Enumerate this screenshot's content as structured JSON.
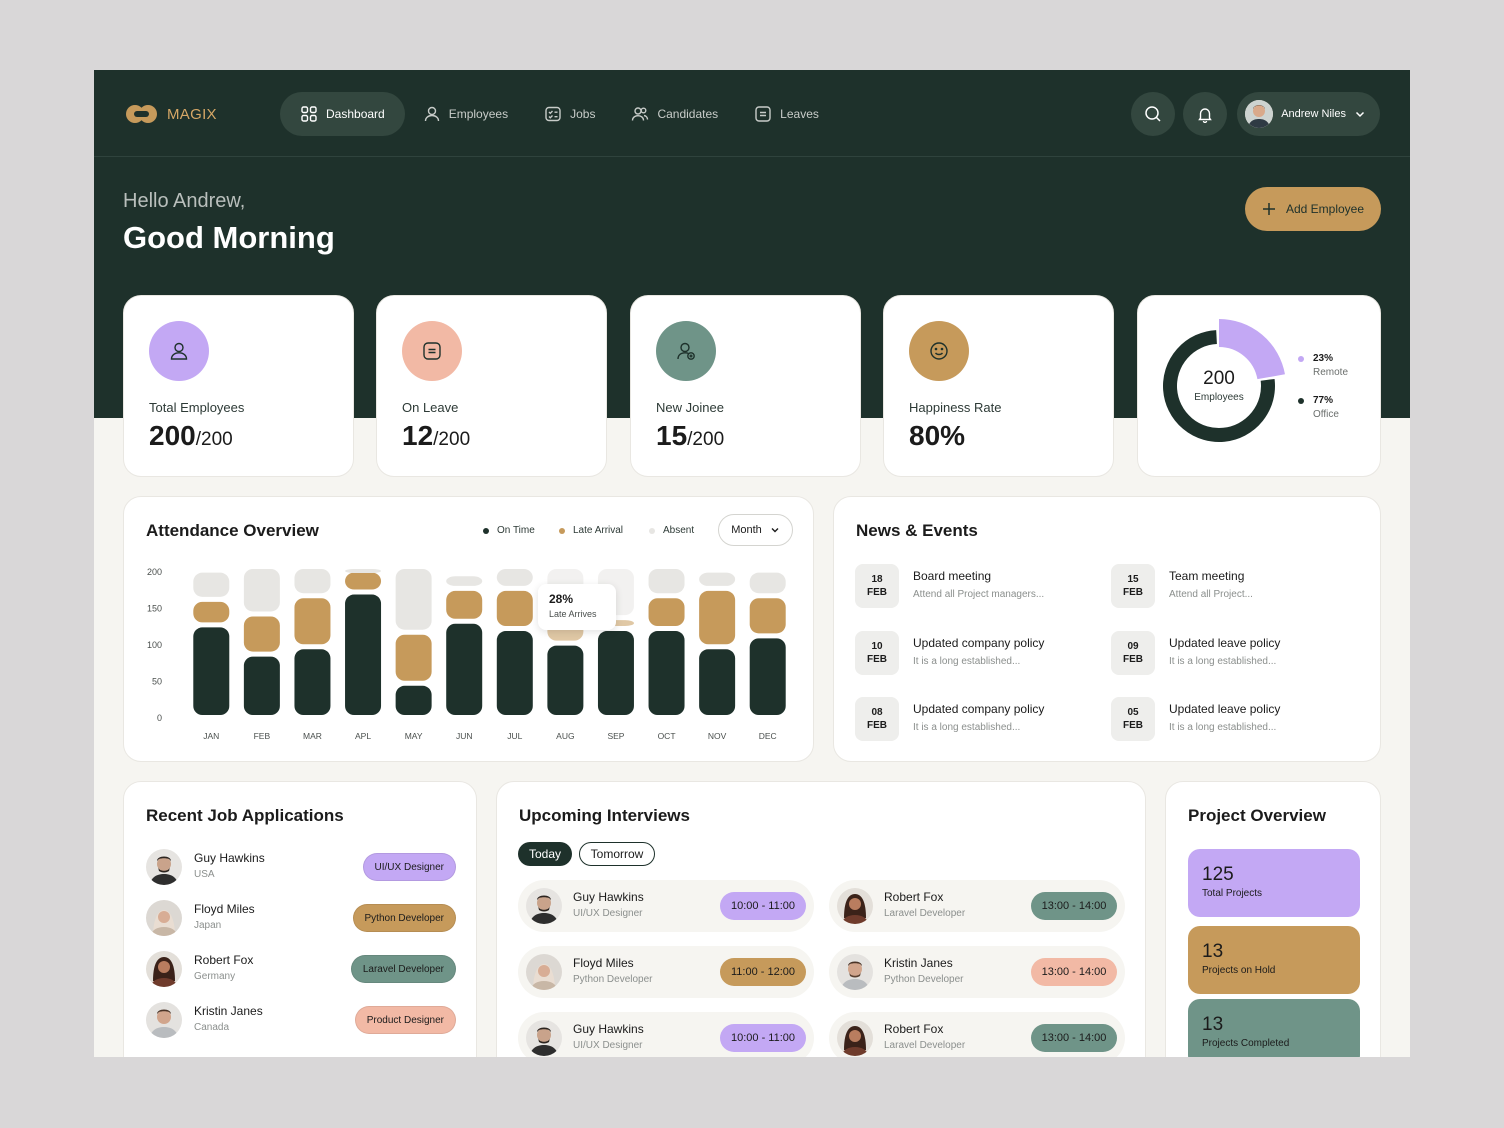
{
  "app": {
    "name": "MAGIX"
  },
  "nav": {
    "items": [
      {
        "label": "Dashboard",
        "icon": "grid-icon",
        "active": true
      },
      {
        "label": "Employees",
        "icon": "user-icon"
      },
      {
        "label": "Jobs",
        "icon": "jobs-icon"
      },
      {
        "label": "Candidates",
        "icon": "users-icon"
      },
      {
        "label": "Leaves",
        "icon": "leaves-icon"
      }
    ],
    "user_name": "Andrew Niles"
  },
  "hero": {
    "greeting": "Hello Andrew,",
    "title": "Good Morning",
    "add_button": "Add Employee"
  },
  "stats": [
    {
      "label": "Total Employees",
      "value": "200",
      "suffix": "/200",
      "color": "#c3a8f4",
      "icon": "user-icon"
    },
    {
      "label": "On Leave",
      "value": "12",
      "suffix": "/200",
      "color": "#f2b9a5",
      "icon": "leave-icon"
    },
    {
      "label": "New Joinee",
      "value": "15",
      "suffix": "/200",
      "color": "#6f9488",
      "icon": "user-add-icon"
    },
    {
      "label": "Happiness Rate",
      "value": "80%",
      "suffix": "",
      "color": "#c69a5b",
      "icon": "smile-icon"
    }
  ],
  "workforce": {
    "total": "200",
    "total_label": "Employees",
    "segments": [
      {
        "pct": "23%",
        "name": "Remote",
        "value": 23,
        "color": "#c3a8f4"
      },
      {
        "pct": "77%",
        "name": "Office",
        "value": 77,
        "color": "#1e312b"
      }
    ]
  },
  "attendance": {
    "title": "Attendance Overview",
    "legend": [
      {
        "label": "On Time",
        "color": "#1e312b"
      },
      {
        "label": "Late Arrival",
        "color": "#c69a5b"
      },
      {
        "label": "Absent",
        "color": "#e7e6e3"
      }
    ],
    "period": "Month",
    "tooltip": {
      "value": "28%",
      "label": "Late Arrives"
    }
  },
  "chart_data": {
    "type": "bar",
    "stacked": true,
    "categories": [
      "JAN",
      "FEB",
      "MAR",
      "APL",
      "MAY",
      "JUN",
      "JUL",
      "AUG",
      "SEP",
      "OCT",
      "NOV",
      "DEC"
    ],
    "y_ticks": [
      "200",
      "150",
      "100",
      "50",
      "0"
    ],
    "ylim": [
      0,
      200
    ],
    "grid": false,
    "legend_position": "top-right",
    "highlight_categories": [
      "AUG",
      "SEP"
    ],
    "series": [
      {
        "name": "On Time",
        "color": "#1e312b",
        "values": [
          120,
          80,
          90,
          165,
          40,
          125,
          115,
          95,
          115,
          115,
          90,
          105
        ]
      },
      {
        "name": "Late Arrival",
        "color": "#c69a5b",
        "values": [
          35,
          55,
          70,
          30,
          70,
          45,
          55,
          35,
          15,
          45,
          80,
          55
        ]
      },
      {
        "name": "Absent",
        "color": "#e7e6e3",
        "values": [
          40,
          65,
          40,
          5,
          90,
          20,
          30,
          70,
          70,
          40,
          25,
          35
        ]
      }
    ]
  },
  "news": {
    "title": "News & Events",
    "items": [
      {
        "day": "18",
        "month": "FEB",
        "title": "Board meeting",
        "desc": "Attend all Project managers..."
      },
      {
        "day": "15",
        "month": "FEB",
        "title": "Team meeting",
        "desc": "Attend all Project..."
      },
      {
        "day": "10",
        "month": "FEB",
        "title": "Updated company policy",
        "desc": "It is a long established..."
      },
      {
        "day": "09",
        "month": "FEB",
        "title": "Updated leave policy",
        "desc": "It is a long established..."
      },
      {
        "day": "08",
        "month": "FEB",
        "title": "Updated company policy",
        "desc": "It is a long established..."
      },
      {
        "day": "05",
        "month": "FEB",
        "title": "Updated leave policy",
        "desc": "It is a long established..."
      }
    ]
  },
  "jobs": {
    "title": "Recent Job Applications",
    "items": [
      {
        "name": "Guy Hawkins",
        "location": "USA",
        "role": "UI/UX Designer",
        "color": "#c3a8f4"
      },
      {
        "name": "Floyd Miles",
        "location": "Japan",
        "role": "Python Developer",
        "color": "#c69a5b"
      },
      {
        "name": "Robert Fox",
        "location": "Germany",
        "role": "Laravel Developer",
        "color": "#6f9488"
      },
      {
        "name": "Kristin Janes",
        "location": "Canada",
        "role": "Product Designer",
        "color": "#f2b9a5"
      }
    ]
  },
  "interviews": {
    "title": "Upcoming Interviews",
    "tabs": [
      "Today",
      "Tomorrow"
    ],
    "items": [
      {
        "name": "Guy Hawkins",
        "role": "UI/UX Designer",
        "time": "10:00 - 11:00",
        "color": "#c3a8f4"
      },
      {
        "name": "Robert Fox",
        "role": "Laravel Developer",
        "time": "13:00 - 14:00",
        "color": "#6f9488"
      },
      {
        "name": "Floyd Miles",
        "role": "Python Developer",
        "time": "11:00 - 12:00",
        "color": "#c69a5b"
      },
      {
        "name": "Kristin Janes",
        "role": "Python Developer",
        "time": "13:00 - 14:00",
        "color": "#f2b9a5"
      },
      {
        "name": "Guy Hawkins",
        "role": "UI/UX Designer",
        "time": "10:00 - 11:00",
        "color": "#c3a8f4"
      },
      {
        "name": "Robert Fox",
        "role": "Laravel Developer",
        "time": "13:00 - 14:00",
        "color": "#6f9488"
      }
    ]
  },
  "projects": {
    "title": "Project Overview",
    "items": [
      {
        "value": "125",
        "label": "Total Projects",
        "color": "#c3a8f4"
      },
      {
        "value": "13",
        "label": "Projects on Hold",
        "color": "#c69a5b"
      },
      {
        "value": "13",
        "label": "Projects Completed",
        "color": "#6f9488"
      }
    ]
  }
}
